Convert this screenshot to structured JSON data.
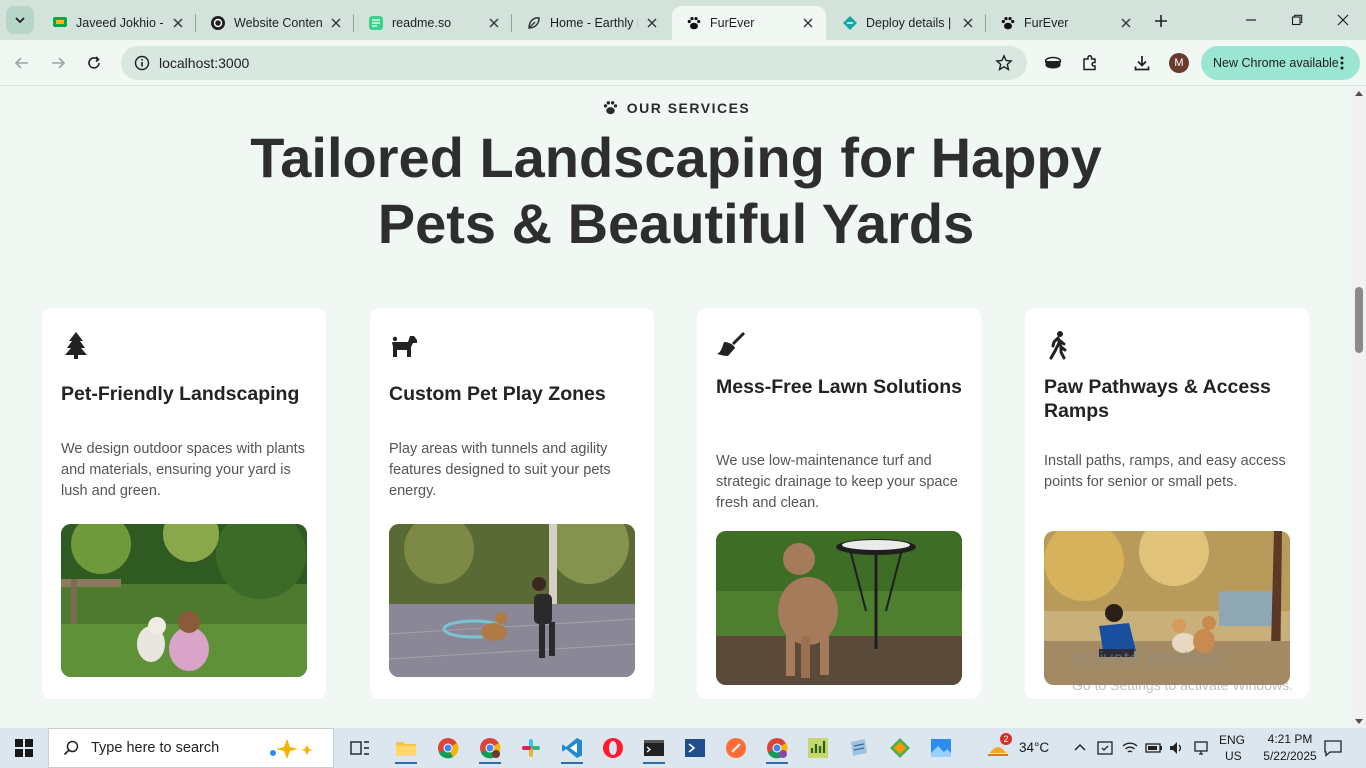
{
  "browser": {
    "tabs": [
      {
        "title": "Javeed Jokhio - (",
        "icon": "google-chat-icon"
      },
      {
        "title": "Website Content",
        "icon": "openai-icon"
      },
      {
        "title": "readme.so",
        "icon": "readme-icon"
      },
      {
        "title": "Home - Earthly D",
        "icon": "leaf-icon"
      },
      {
        "title": "FurEver",
        "icon": "paw-icon",
        "active": true
      },
      {
        "title": "Deploy details |",
        "icon": "netlify-icon"
      },
      {
        "title": "FurEver",
        "icon": "paw-icon"
      }
    ],
    "url": "localhost:3000",
    "avatar_letter": "M",
    "update_label": "New Chrome available"
  },
  "page": {
    "eyebrow": "OUR SERVICES",
    "headline_line1": "Tailored Landscaping for Happy",
    "headline_line2": "Pets & Beautiful Yards",
    "cards": [
      {
        "icon": "tree-icon",
        "title": "Pet-Friendly Landscaping",
        "description": "We design outdoor spaces with plants and materials, ensuring your yard is lush and green."
      },
      {
        "icon": "dog-icon",
        "title": "Custom Pet Play Zones",
        "description": "Play areas with tunnels and agility features designed to suit your pets energy."
      },
      {
        "icon": "broom-icon",
        "title": "Mess-Free Lawn Solutions",
        "description": "We use low-maintenance turf and strategic drainage to keep your space fresh and clean."
      },
      {
        "icon": "person-walking-icon",
        "title": "Paw Pathways & Access Ramps",
        "description": "Install paths, ramps, and easy access points for senior or small pets."
      }
    ]
  },
  "windows": {
    "activation_title": "Activate Windows",
    "activation_sub": "Go to Settings to activate Windows.",
    "search_placeholder": "Type here to search",
    "weather": "34°C",
    "weather_badge": "2",
    "lang1": "ENG",
    "lang2": "US",
    "time": "4:21 PM",
    "date": "5/22/2025"
  },
  "colors": {
    "page_bg": "#f1f8f4",
    "card_bg": "#ffffff",
    "heading": "#2e2e2e",
    "tabstrip": "#d3e3dc",
    "new_chrome": "#9be6d2"
  }
}
